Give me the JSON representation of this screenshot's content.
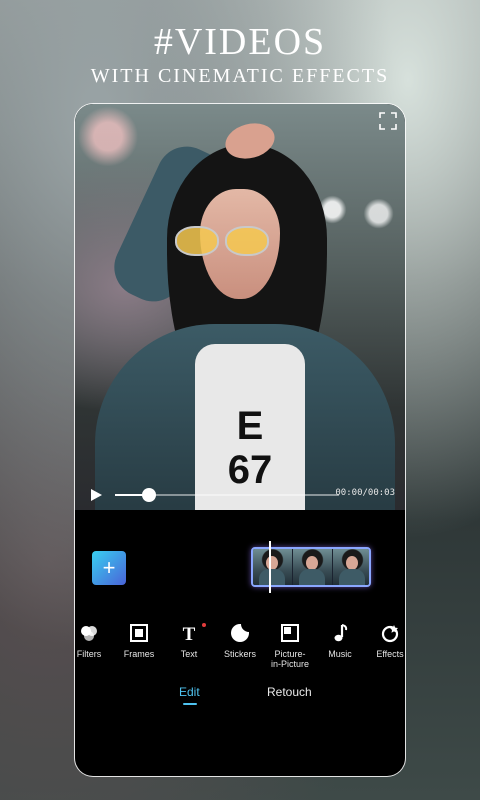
{
  "promo": {
    "headline": "#VIDEOS",
    "subheadline": "WITH CINEMATIC EFFECTS"
  },
  "player": {
    "time": "00:00/00:03",
    "progress": 0.15
  },
  "timeline": {
    "add_label": "+"
  },
  "tools": [
    {
      "label": "Filters",
      "icon": "filters-icon"
    },
    {
      "label": "Frames",
      "icon": "frames-icon"
    },
    {
      "label": "Text",
      "icon": "text-icon",
      "badge": true
    },
    {
      "label": "Stickers",
      "icon": "stickers-icon"
    },
    {
      "label": "Picture-\nin-Picture",
      "icon": "picture-in-picture-icon"
    },
    {
      "label": "Music",
      "icon": "music-icon"
    },
    {
      "label": "Effects",
      "icon": "effects-icon"
    }
  ],
  "modes": {
    "edit": "Edit",
    "retouch": "Retouch",
    "active": "edit"
  },
  "colors": {
    "accent": "#4fc3f0",
    "add_button_start": "#38d0f0",
    "add_button_end": "#4a63d8",
    "badge": "#e23b3b"
  }
}
